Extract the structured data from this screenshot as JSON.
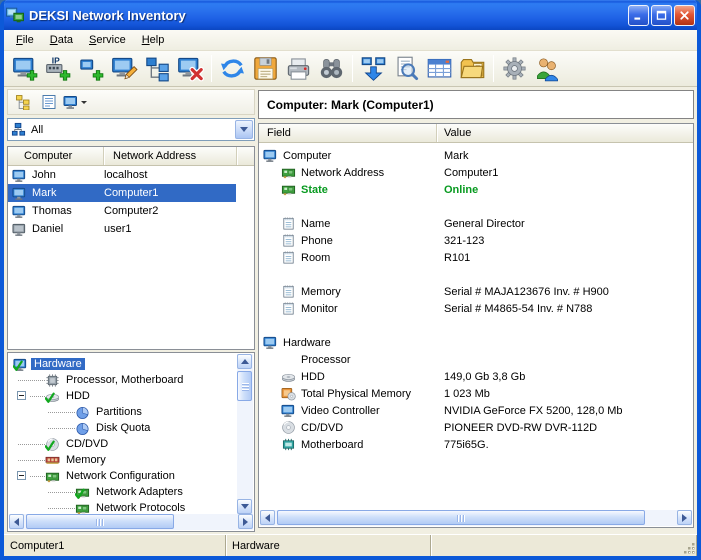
{
  "colors": {
    "selection": "#316ac5",
    "status_online": "#089a20",
    "titlebar": "#1f62e6",
    "statusbar_bg": "#ece9d8"
  },
  "titlebar": {
    "title": "DEKSI Network Inventory",
    "buttons": [
      {
        "icon": "minimize"
      },
      {
        "icon": "maximize"
      },
      {
        "icon": "close"
      }
    ]
  },
  "menu": {
    "items": [
      {
        "label": "File"
      },
      {
        "label": "Data"
      },
      {
        "label": "Service"
      },
      {
        "label": "Help"
      }
    ]
  },
  "toolbar": {
    "buttons": [
      {
        "icon": "add-computer"
      },
      {
        "icon": "add-ip-range"
      },
      {
        "icon": "add-host"
      },
      {
        "icon": "edit-computer"
      },
      {
        "icon": "network-map"
      },
      {
        "icon": "delete-computer",
        "sep": true
      },
      {
        "icon": "refresh"
      },
      {
        "icon": "save"
      },
      {
        "icon": "print"
      },
      {
        "icon": "find",
        "sep": true
      },
      {
        "icon": "scan-network"
      },
      {
        "icon": "preview-report"
      },
      {
        "icon": "report-table"
      },
      {
        "icon": "reports-folder",
        "sep": true
      },
      {
        "icon": "settings"
      },
      {
        "icon": "users"
      }
    ]
  },
  "left_panel": {
    "view_toolbar": {
      "buttons": [
        {
          "icon": "group-tree"
        },
        {
          "icon": "details-view"
        },
        {
          "icon": "computer-view",
          "dropdown": true
        }
      ]
    },
    "filter_combo": {
      "value": "All",
      "icon": "network"
    },
    "computer_list": {
      "columns": [
        {
          "label": "Computer"
        },
        {
          "label": "Network Address"
        },
        {
          "label": ""
        }
      ],
      "rows": [
        {
          "icon": "monitor",
          "name": "John",
          "address": "localhost"
        },
        {
          "icon": "monitor",
          "name": "Mark",
          "address": "Computer1",
          "selected": true
        },
        {
          "icon": "monitor",
          "name": "Thomas",
          "address": "Computer2"
        },
        {
          "icon": "monitor-gray",
          "name": "Daniel",
          "address": "user1"
        }
      ]
    },
    "category_tree": {
      "items": [
        {
          "icon": "monitor-check",
          "label": "Hardware",
          "depth": 0,
          "selected": true
        },
        {
          "icon": "chip",
          "label": "Processor, Motherboard",
          "depth": 1
        },
        {
          "icon": "hdd-check",
          "label": "HDD",
          "depth": 1,
          "expander": "minus"
        },
        {
          "icon": "pie",
          "label": "Partitions",
          "depth": 2
        },
        {
          "icon": "pie",
          "label": "Disk Quota",
          "depth": 2
        },
        {
          "icon": "disc-check",
          "label": "CD/DVD",
          "depth": 1
        },
        {
          "icon": "ram",
          "label": "Memory",
          "depth": 1
        },
        {
          "icon": "netcard",
          "label": "Network Configuration",
          "depth": 1,
          "expander": "minus"
        },
        {
          "icon": "netcard-check",
          "label": "Network Adapters",
          "depth": 2
        },
        {
          "icon": "netcard",
          "label": "Network Protocols",
          "depth": 2
        }
      ]
    }
  },
  "detail_panel": {
    "header": "Computer: Mark (Computer1)",
    "table": {
      "columns": [
        {
          "label": "Field"
        },
        {
          "label": "Value"
        }
      ],
      "rows": [
        {
          "icon": "monitor",
          "field": "Computer",
          "value": "Mark",
          "indent": 0
        },
        {
          "icon": "netcard",
          "field": "Network Address",
          "value": "Computer1",
          "indent": 1
        },
        {
          "icon": "netcard",
          "field": "State",
          "value": "Online",
          "indent": 1,
          "highlight": true
        },
        {
          "field": "",
          "value": "",
          "spacer": true
        },
        {
          "icon": "notepad",
          "field": "Name",
          "value": "General Director",
          "indent": 1
        },
        {
          "icon": "notepad",
          "field": "Phone",
          "value": "321-123",
          "indent": 1
        },
        {
          "icon": "notepad",
          "field": "Room",
          "value": "R101",
          "indent": 1
        },
        {
          "field": "",
          "value": "",
          "spacer": true
        },
        {
          "icon": "notepad",
          "field": "Memory",
          "value": "Serial # MAJA123676 Inv. # H900",
          "indent": 1
        },
        {
          "icon": "notepad",
          "field": "Monitor",
          "value": "Serial # M4865-54 Inv. # N788",
          "indent": 1
        },
        {
          "field": "",
          "value": "",
          "spacer": true
        },
        {
          "icon": "monitor",
          "field": "Hardware",
          "value": "",
          "indent": 0
        },
        {
          "field": "Processor",
          "value": "",
          "indent": 1
        },
        {
          "icon": "hdd",
          "field": "HDD",
          "value": "149,0 Gb 3,8 Gb",
          "indent": 1
        },
        {
          "icon": "mem-disc",
          "field": "Total Physical Memory",
          "value": "1 023 Mb",
          "indent": 1
        },
        {
          "icon": "monitor",
          "field": "Video Controller",
          "value": "NVIDIA GeForce FX 5200, 128,0 Mb",
          "indent": 1
        },
        {
          "icon": "disc",
          "field": "CD/DVD",
          "value": "PIONEER DVD-RW  DVR-112D",
          "indent": 1
        },
        {
          "icon": "chip-teal",
          "field": "Motherboard",
          "value": "775i65G.",
          "indent": 1
        }
      ]
    }
  },
  "statusbar": {
    "panels": [
      {
        "text": "Computer1"
      },
      {
        "text": "Hardware"
      },
      {
        "text": ""
      },
      {
        "text": ""
      }
    ]
  }
}
